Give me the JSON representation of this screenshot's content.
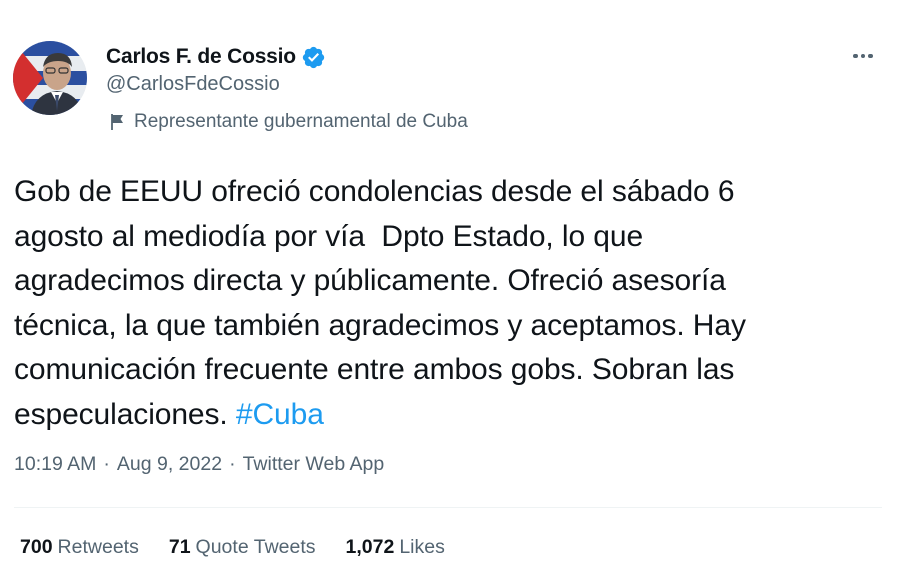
{
  "author": {
    "display_name": "Carlos F. de Cossio",
    "handle": "@CarlosFdeCossio",
    "label": "Representante gubernamental de Cuba",
    "verified_color": "#1d9bf0"
  },
  "tweet": {
    "text_main": "Gob de EEUU ofreció condolencias desde el sábado 6\nagosto al mediodía por vía  Dpto Estado, lo que\nagradecimos directa y públicamente. Ofreció asesoría\ntécnica, la que también agradecimos y aceptamos. Hay\ncomunicación frecuente entre ambos gobs. Sobran las\nespeculaciones. ",
    "hashtag": "#Cuba",
    "time": "10:19 AM",
    "date": "Aug 9, 2022",
    "source": "Twitter Web App",
    "separator": "·"
  },
  "stats": {
    "retweets_count": "700",
    "retweets_label": "Retweets",
    "quotes_count": "71",
    "quotes_label": "Quote Tweets",
    "likes_count": "1,072",
    "likes_label": "Likes"
  },
  "icons": {
    "more": "more-options-icon",
    "verified": "verified-badge-icon",
    "flag": "flag-icon"
  }
}
